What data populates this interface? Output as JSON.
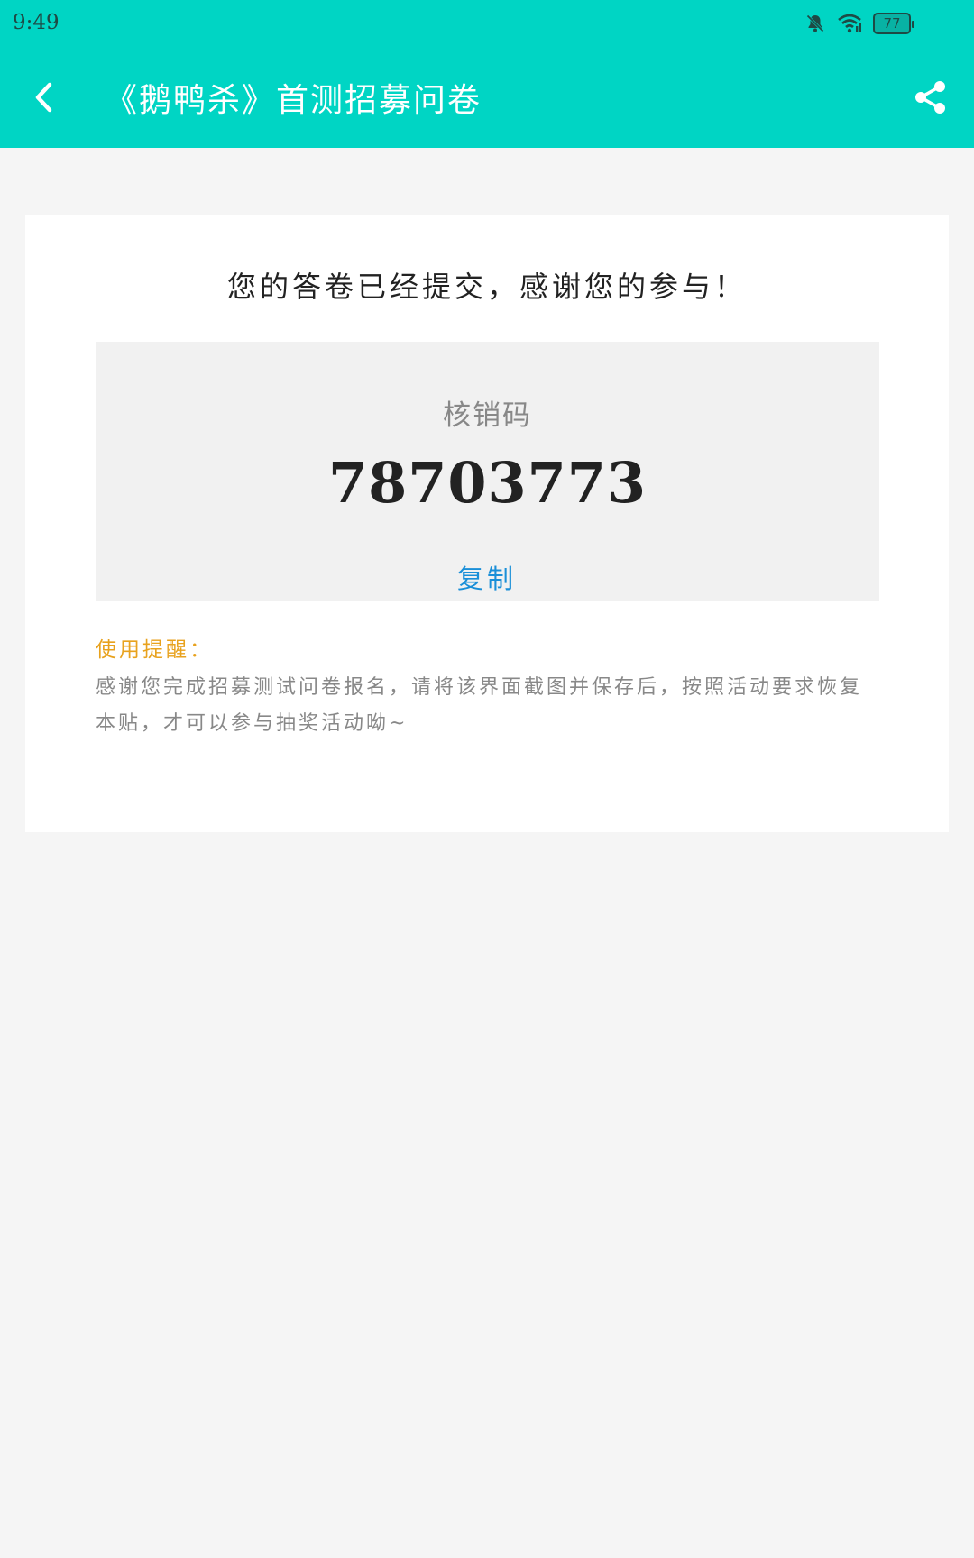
{
  "status_bar": {
    "time": "9:49",
    "icons": [
      "bell-muted-icon",
      "wifi-icon"
    ],
    "battery": "77"
  },
  "header": {
    "back_icon": "chevron-left-icon",
    "title": "《鹅鸭杀》首测招募问卷",
    "share_icon": "share-icon",
    "background_color": "#00d5c4"
  },
  "card": {
    "heading": "您的答卷已经提交，感谢您的参与！",
    "code_label": "核销码",
    "code_value": "78703773",
    "copy_label": "复制",
    "tip_title": "使用提醒：",
    "tip_text": "感谢您完成招募测试问卷报名，请将该界面截图并保存后，按照活动要求恢复本贴，才可以参与抽奖活动呦~"
  },
  "colors": {
    "accent": "#00d5c4",
    "link": "#1a8fd8",
    "warning": "#e8a21e"
  }
}
